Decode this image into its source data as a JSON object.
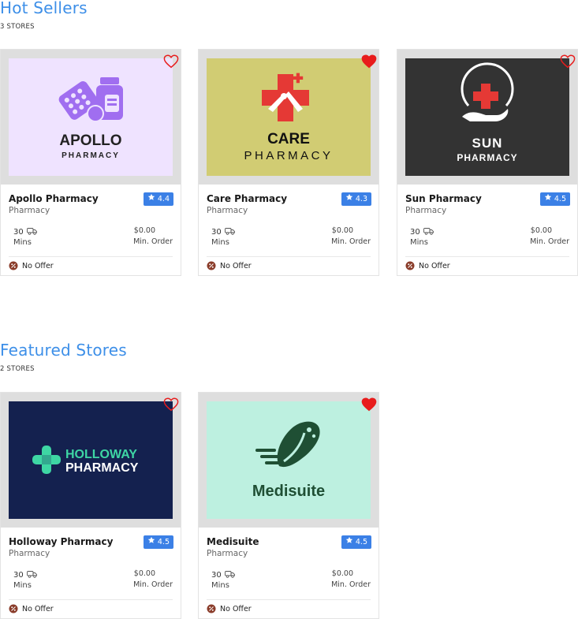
{
  "sections": [
    {
      "title": "Hot Sellers",
      "count": "3 STORES",
      "stores": [
        {
          "name": "Apollo Pharmacy",
          "category": "Pharmacy",
          "rating": "4.4",
          "time": "30",
          "time_unit": "Mins",
          "min_order": "$0.00",
          "min_order_label": "Min. Order",
          "offer": "No Offer",
          "favorite": false,
          "logo": {
            "line1": "APOLLO",
            "line2": "PHARMACY",
            "bg": "#efe3ff",
            "accent": "#a06ef0"
          }
        },
        {
          "name": "Care Pharmacy",
          "category": "Pharmacy",
          "rating": "4.3",
          "time": "30",
          "time_unit": "Mins",
          "min_order": "$0.00",
          "min_order_label": "Min. Order",
          "offer": "No Offer",
          "favorite": true,
          "logo": {
            "line1": "CARE",
            "line2": "PHARMACY",
            "bg": "#d1cc73",
            "accent": "#e53935"
          }
        },
        {
          "name": "Sun Pharmacy",
          "category": "Pharmacy",
          "rating": "4.5",
          "time": "30",
          "time_unit": "Mins",
          "min_order": "$0.00",
          "min_order_label": "Min. Order",
          "offer": "No Offer",
          "favorite": false,
          "logo": {
            "line1": "SUN",
            "line2": "PHARMACY",
            "bg": "#333333",
            "accent": "#e53935"
          }
        }
      ]
    },
    {
      "title": "Featured Stores",
      "count": "2 STORES",
      "stores": [
        {
          "name": "Holloway Pharmacy",
          "category": "Pharmacy",
          "rating": "4.5",
          "time": "30",
          "time_unit": "Mins",
          "min_order": "$0.00",
          "min_order_label": "Min. Order",
          "offer": "No Offer",
          "favorite": false,
          "logo": {
            "line1": "HOLLOWAY",
            "line2": "PHARMACY",
            "bg": "#14214f",
            "accent": "#3ed6a4"
          }
        },
        {
          "name": "Medisuite",
          "category": "Pharmacy",
          "rating": "4.5",
          "time": "30",
          "time_unit": "Mins",
          "min_order": "$0.00",
          "min_order_label": "Min. Order",
          "offer": "No Offer",
          "favorite": true,
          "logo": {
            "line1": "Medisuite",
            "bg": "#bdf0e0",
            "accent": "#1f4f34"
          }
        }
      ]
    }
  ],
  "icons": {
    "favorite": "heart-icon",
    "rating": "star-icon",
    "delivery": "delivery-truck-icon",
    "offer": "discount-badge-icon"
  },
  "colors": {
    "section_title": "#3d8fe8",
    "rating_badge": "#3b80e6",
    "heart": "#e81c1c",
    "offer_badge": "#8a3c2a"
  }
}
